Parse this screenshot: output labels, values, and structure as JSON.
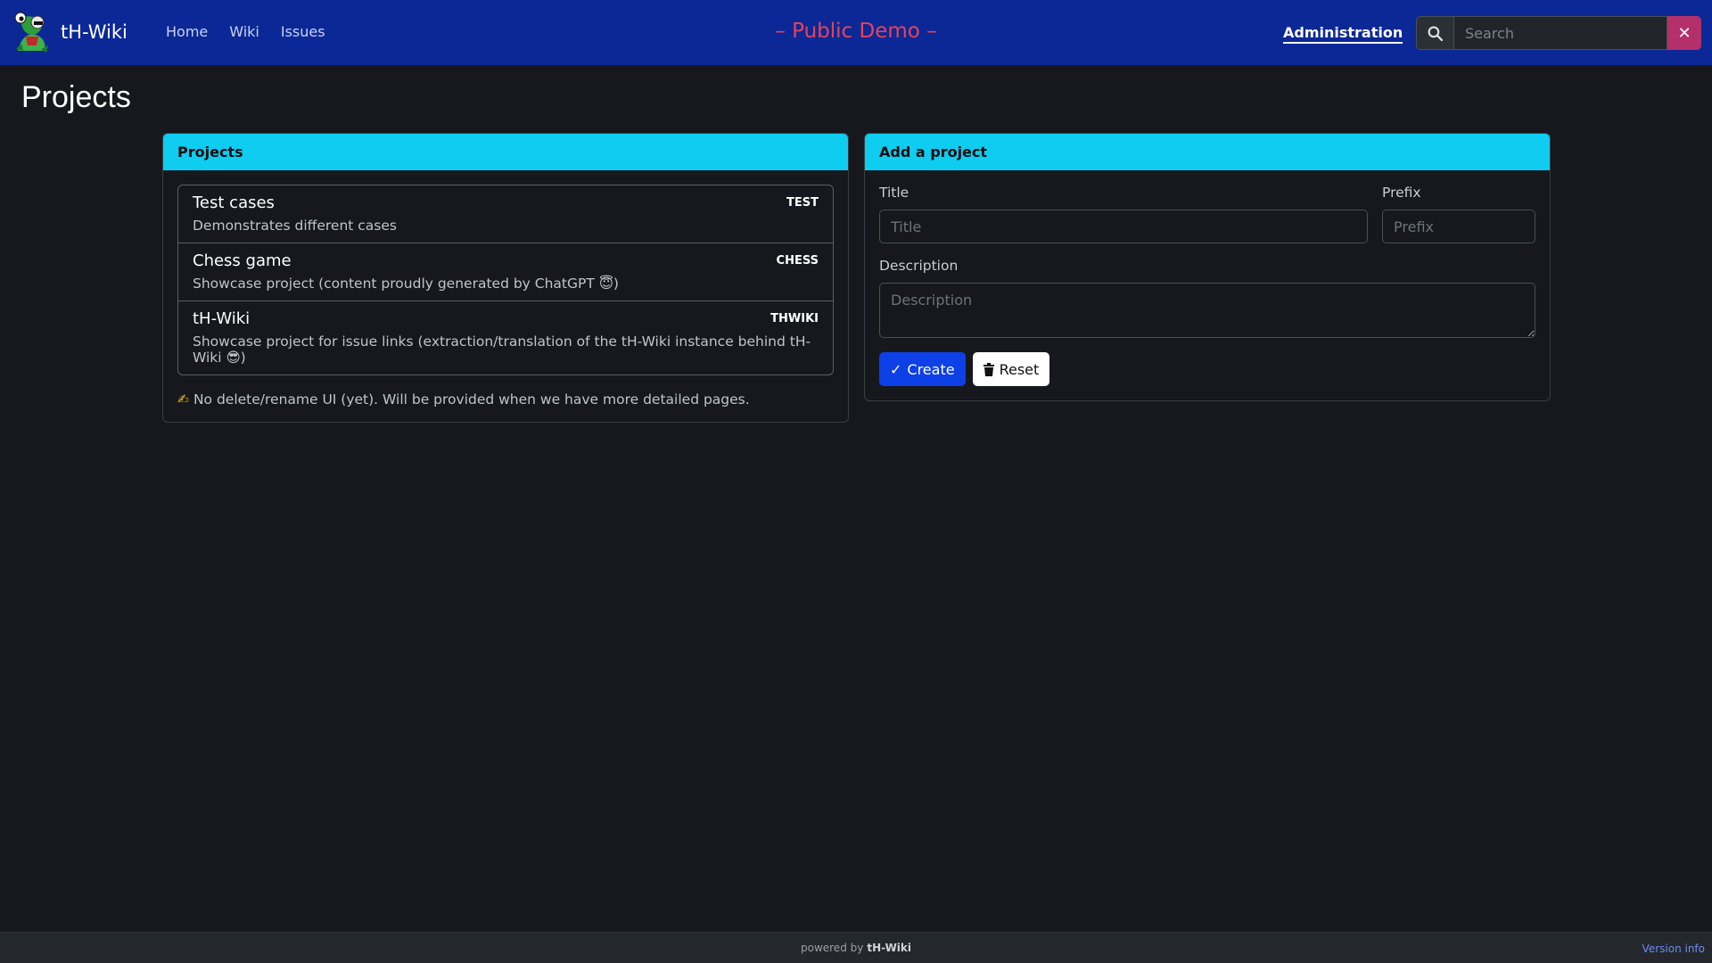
{
  "navbar": {
    "brand": "tH-Wiki",
    "links": [
      "Home",
      "Wiki",
      "Issues"
    ],
    "banner": "– Public Demo –",
    "admin": "Administration",
    "search_placeholder": "Search",
    "clear_glyph": "✕"
  },
  "page": {
    "title": "Projects"
  },
  "projects_card": {
    "header": "Projects",
    "items": [
      {
        "title": "Test cases",
        "prefix": "TEST",
        "description": "Demonstrates different cases"
      },
      {
        "title": "Chess game",
        "prefix": "CHESS",
        "description": "Showcase project (content proudly generated by ChatGPT 😇)"
      },
      {
        "title": "tH-Wiki",
        "prefix": "THWIKI",
        "description": "Showcase project for issue links (extraction/translation of the tH-Wiki instance behind tH-Wiki 😎)"
      }
    ],
    "note_icon": "✍",
    "note": "No delete/rename UI (yet). Will be provided when we have more detailed pages."
  },
  "add_card": {
    "header": "Add a project",
    "title_label": "Title",
    "title_placeholder": "Title",
    "prefix_label": "Prefix",
    "prefix_placeholder": "Prefix",
    "description_label": "Description",
    "description_placeholder": "Description",
    "create_label": "Create",
    "reset_label": "Reset"
  },
  "footer": {
    "powered_by": "powered by",
    "brand": "tH-Wiki",
    "version": "Version info"
  }
}
